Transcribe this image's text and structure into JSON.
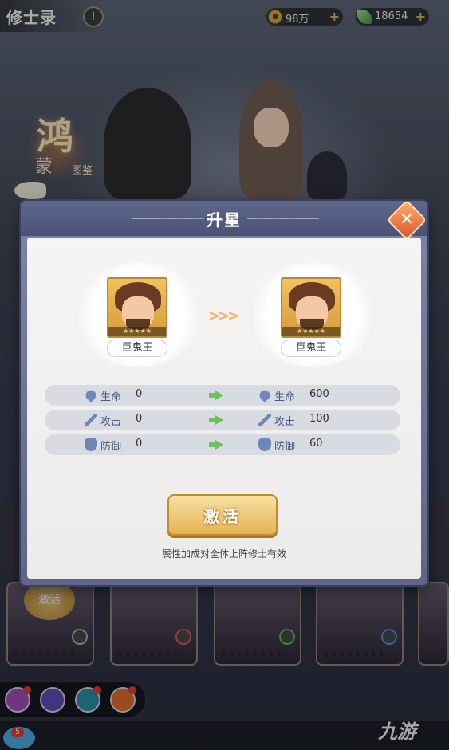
{
  "page": {
    "title": "修士录"
  },
  "resources": [
    {
      "icon": "coin-icon",
      "value": "98万"
    },
    {
      "icon": "jade-leaf-icon",
      "value": "18654"
    }
  ],
  "seal": {
    "big": "鸿",
    "small": "蒙",
    "tiny": "图鉴"
  },
  "background_card": {
    "activate_label": "激活"
  },
  "modal": {
    "title": "升星",
    "close_symbol": "✕",
    "from": {
      "name": "巨鬼王"
    },
    "to": {
      "name": "巨鬼王"
    },
    "chevrons": ">>>",
    "stats": [
      {
        "icon": "heart-icon",
        "label": "生命",
        "from": "0",
        "to": "600"
      },
      {
        "icon": "sword-icon",
        "label": "攻击",
        "from": "0",
        "to": "100"
      },
      {
        "icon": "shield-icon",
        "label": "防御",
        "from": "0",
        "to": "60"
      }
    ],
    "activate_label": "激活",
    "hint": "属性加成对全体上阵修士有效"
  },
  "bottom": {
    "notification_count": "5",
    "watermark": "九游"
  },
  "colors": {
    "accent_gold": "#e4b452",
    "stat_blue": "#6f86b8",
    "arrow_green": "#6cc15a",
    "close_orange": "#e0522a"
  }
}
